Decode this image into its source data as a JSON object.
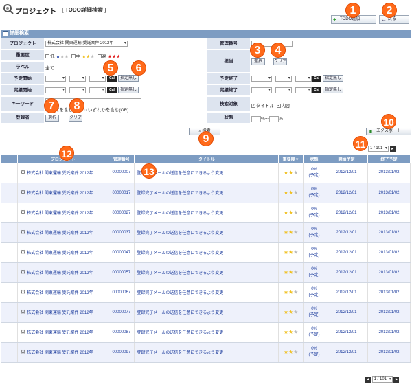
{
  "header": {
    "title": "プロジェクト",
    "subtitle": "[ TODO詳細検索 ]"
  },
  "toolbar": {
    "add_label": "TODO追加",
    "back_label": "戻る"
  },
  "section": {
    "title": "詳細検索"
  },
  "form": {
    "project_label": "プロジェクト",
    "project_value": "株式会社 関東運輸 受託案件 2012年",
    "manage_no_label": "管理番号",
    "importance_label": "重要度",
    "imp_low": "低",
    "imp_mid": "中",
    "imp_high": "高",
    "label_label": "ラベル",
    "label_value": "全て",
    "assignee_label": "担当",
    "select_btn": "選択",
    "clear_btn": "クリア",
    "sched_start_label": "予定開始",
    "sched_end_label": "予定終了",
    "actual_start_label": "実績開始",
    "actual_end_label": "実績終了",
    "cal_label": "Cal",
    "no_date_btn": "指定無し",
    "keyword_label": "キーワード",
    "kw_all": "全てを含む",
    "kw_any": "いずれかを含む(OR)",
    "target_label": "検索対象",
    "target_title": "タイトル",
    "target_content": "内容",
    "registrant_label": "登録者",
    "status_label": "状態",
    "status_from": "%",
    "status_sep": "〜",
    "status_to": "%",
    "search_btn": "検索",
    "export_btn": "エクスポート"
  },
  "pager": {
    "top": "1 / 101",
    "bottom": "1 / 101"
  },
  "table": {
    "headers": [
      "プロジェクト",
      "管理番号",
      "タイトル",
      "重要度▼",
      "状態",
      "開始予定",
      "終了予定"
    ],
    "rows": [
      {
        "project": "株式会社 関東運輸 受託案件 2012年",
        "no": "00000007",
        "title": "登録完了メールの送信を任意にできるよう変更",
        "status": "0%",
        "status2": "(予定)",
        "start": "2012/12/01",
        "end": "2013/01/02"
      },
      {
        "project": "株式会社 関東運輸 受託案件 2012年",
        "no": "00000017",
        "title": "登録完了メールの送信を任意にできるよう変更",
        "status": "0%",
        "status2": "(予定)",
        "start": "2012/12/01",
        "end": "2013/01/02"
      },
      {
        "project": "株式会社 関東運輸 受託案件 2012年",
        "no": "00000027",
        "title": "登録完了メールの送信を任意にできるよう変更",
        "status": "0%",
        "status2": "(予定)",
        "start": "2012/12/01",
        "end": "2013/01/02"
      },
      {
        "project": "株式会社 関東運輸 受託案件 2012年",
        "no": "00000037",
        "title": "登録完了メールの送信を任意にできるよう変更",
        "status": "0%",
        "status2": "(予定)",
        "start": "2012/12/01",
        "end": "2013/01/02"
      },
      {
        "project": "株式会社 関東運輸 受託案件 2012年",
        "no": "00000047",
        "title": "登録完了メールの送信を任意にできるよう変更",
        "status": "0%",
        "status2": "(予定)",
        "start": "2012/12/01",
        "end": "2013/01/02"
      },
      {
        "project": "株式会社 関東運輸 受託案件 2012年",
        "no": "00000057",
        "title": "登録完了メールの送信を任意にできるよう変更",
        "status": "0%",
        "status2": "(予定)",
        "start": "2012/12/01",
        "end": "2013/01/02"
      },
      {
        "project": "株式会社 関東運輸 受託案件 2012年",
        "no": "00000067",
        "title": "登録完了メールの送信を任意にできるよう変更",
        "status": "0%",
        "status2": "(予定)",
        "start": "2012/12/01",
        "end": "2013/01/02"
      },
      {
        "project": "株式会社 関東運輸 受託案件 2012年",
        "no": "00000077",
        "title": "登録完了メールの送信を任意にできるよう変更",
        "status": "0%",
        "status2": "(予定)",
        "start": "2012/12/01",
        "end": "2013/01/02"
      },
      {
        "project": "株式会社 関東運輸 受託案件 2012年",
        "no": "00000087",
        "title": "登録完了メールの送信を任意にできるよう変更",
        "status": "0%",
        "status2": "(予定)",
        "start": "2012/12/01",
        "end": "2013/01/02"
      },
      {
        "project": "株式会社 関東運輸 受託案件 2012年",
        "no": "00000097",
        "title": "登録完了メールの送信を任意にできるよう変更",
        "status": "0%",
        "status2": "(予定)",
        "start": "2012/12/01",
        "end": "2013/01/02"
      }
    ]
  },
  "callouts": [
    "1",
    "2",
    "3",
    "4",
    "5",
    "6",
    "7",
    "8",
    "9",
    "10",
    "11",
    "12",
    "13"
  ],
  "colors": {
    "accent": "#7d9cc2",
    "callout": "#ff6a1a",
    "star": "#f0c020"
  }
}
